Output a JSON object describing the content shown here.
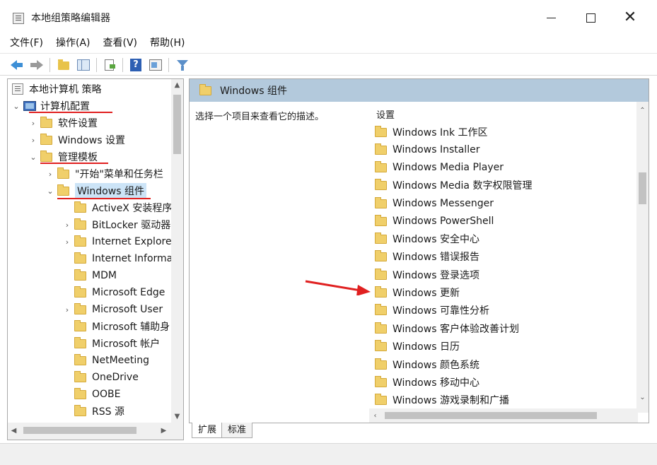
{
  "window": {
    "title": "本地组策略编辑器"
  },
  "menu": [
    "文件(F)",
    "操作(A)",
    "查看(V)",
    "帮助(H)"
  ],
  "tree": {
    "root": "本地计算机 策略",
    "computer_config": "计算机配置",
    "software_settings": "软件设置",
    "windows_settings": "Windows 设置",
    "admin_templates": "管理模板",
    "start_menu": "\"开始\"菜单和任务栏",
    "windows_components": "Windows 组件",
    "children": [
      "ActiveX 安装程序",
      "BitLocker 驱动器",
      "Internet Explorer",
      "Internet Information",
      "MDM",
      "Microsoft Edge",
      "Microsoft User",
      "Microsoft 辅助身",
      "Microsoft 帐户",
      "NetMeeting",
      "OneDrive",
      "OOBE",
      "RSS 源"
    ]
  },
  "right": {
    "header_title": "Windows 组件",
    "description": "选择一个项目来查看它的描述。",
    "settings_column": "设置",
    "settings": [
      "Windows Ink 工作区",
      "Windows Installer",
      "Windows Media Player",
      "Windows Media 数字权限管理",
      "Windows Messenger",
      "Windows PowerShell",
      "Windows 安全中心",
      "Windows 错误报告",
      "Windows 登录选项",
      "Windows 更新",
      "Windows 可靠性分析",
      "Windows 客户体验改善计划",
      "Windows 日历",
      "Windows 颜色系统",
      "Windows 移动中心",
      "Windows 游戏录制和广播"
    ]
  },
  "tabs": {
    "expanded": "扩展",
    "standard": "标准"
  },
  "colors": {
    "annotation": "#e02020",
    "header_bg": "#b3c9dc",
    "selection": "#cce4f7"
  }
}
